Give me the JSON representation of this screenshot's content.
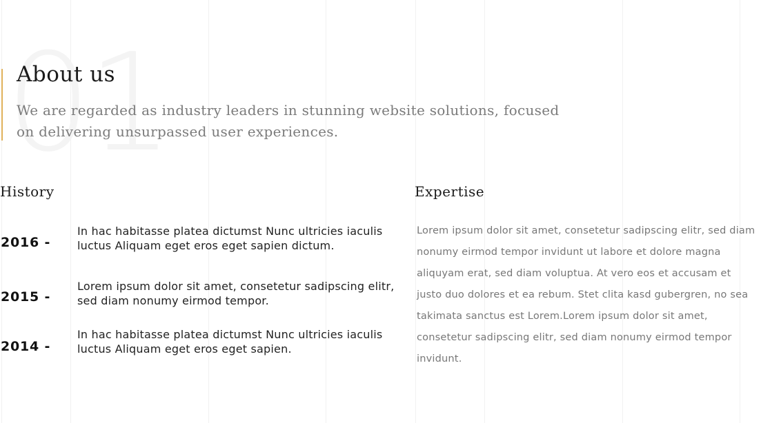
{
  "about": {
    "number": "01",
    "title": "About us",
    "lead": "We are regarded as industry leaders in stunning website solutions, focused on delivering unsurpassed user experiences."
  },
  "history": {
    "heading": "History",
    "items": [
      {
        "year": "2016 -",
        "text": "In hac habitasse platea dictumst Nunc ultricies iaculis luctus Aliquam eget eros eget sapien dictum."
      },
      {
        "year": "2015 -",
        "text": "Lorem ipsum dolor sit amet, consetetur sadipscing elitr, sed diam nonumy eirmod tempor."
      },
      {
        "year": "2014 -",
        "text": "In hac habitasse platea dictumst Nunc ultricies iaculis luctus Aliquam eget eros eget sapien."
      }
    ]
  },
  "expertise": {
    "heading": "Expertise",
    "text": "Lorem ipsum dolor sit amet, consetetur sadipscing elitr, sed diam nonumy eirmod tempor invidunt ut labore et dolore magna aliquyam erat, sed diam voluptua. At vero eos et accusam et justo duo dolores et ea rebum. Stet clita kasd gubergren, no sea takimata sanctus est Lorem.Lorem ipsum dolor sit amet, consetetur sadipscing elitr, sed diam nonumy eirmod tempor invidunt."
  },
  "colors": {
    "accent": "#e0b15a",
    "background": "#ffffff",
    "muted_text": "#777777"
  }
}
